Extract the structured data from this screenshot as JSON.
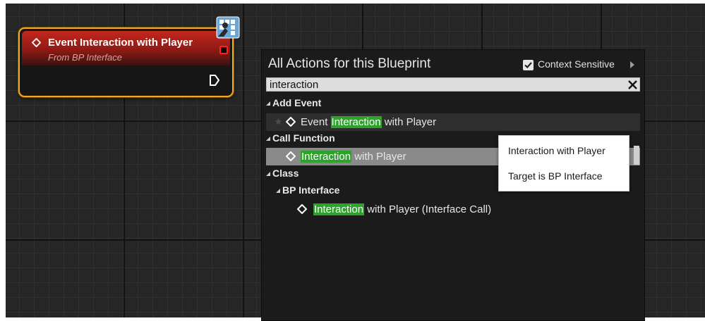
{
  "node": {
    "title": "Event Interaction with Player",
    "subtitle": "From BP Interface"
  },
  "menu": {
    "title": "All Actions for this Blueprint",
    "context_sensitive_label": "Context Sensitive",
    "context_sensitive_checked": true,
    "search_value": "interaction",
    "categories": {
      "add_event": "Add Event",
      "call_function": "Call Function",
      "class": "Class",
      "bp_interface": "BP Interface"
    },
    "items": {
      "event_prefix": "Event ",
      "event_match": "Interaction",
      "event_suffix": " with Player",
      "call_match": "Interaction",
      "call_suffix": " with Player",
      "iface_match": "Interaction",
      "iface_suffix": " with Player (Interface Call)"
    }
  },
  "tooltip": {
    "line1": "Interaction with Player",
    "line2": "Target is BP Interface"
  },
  "colors": {
    "highlight": "#2fa12d",
    "node_border": "#f0a81e",
    "node_header": "#c3271d"
  }
}
